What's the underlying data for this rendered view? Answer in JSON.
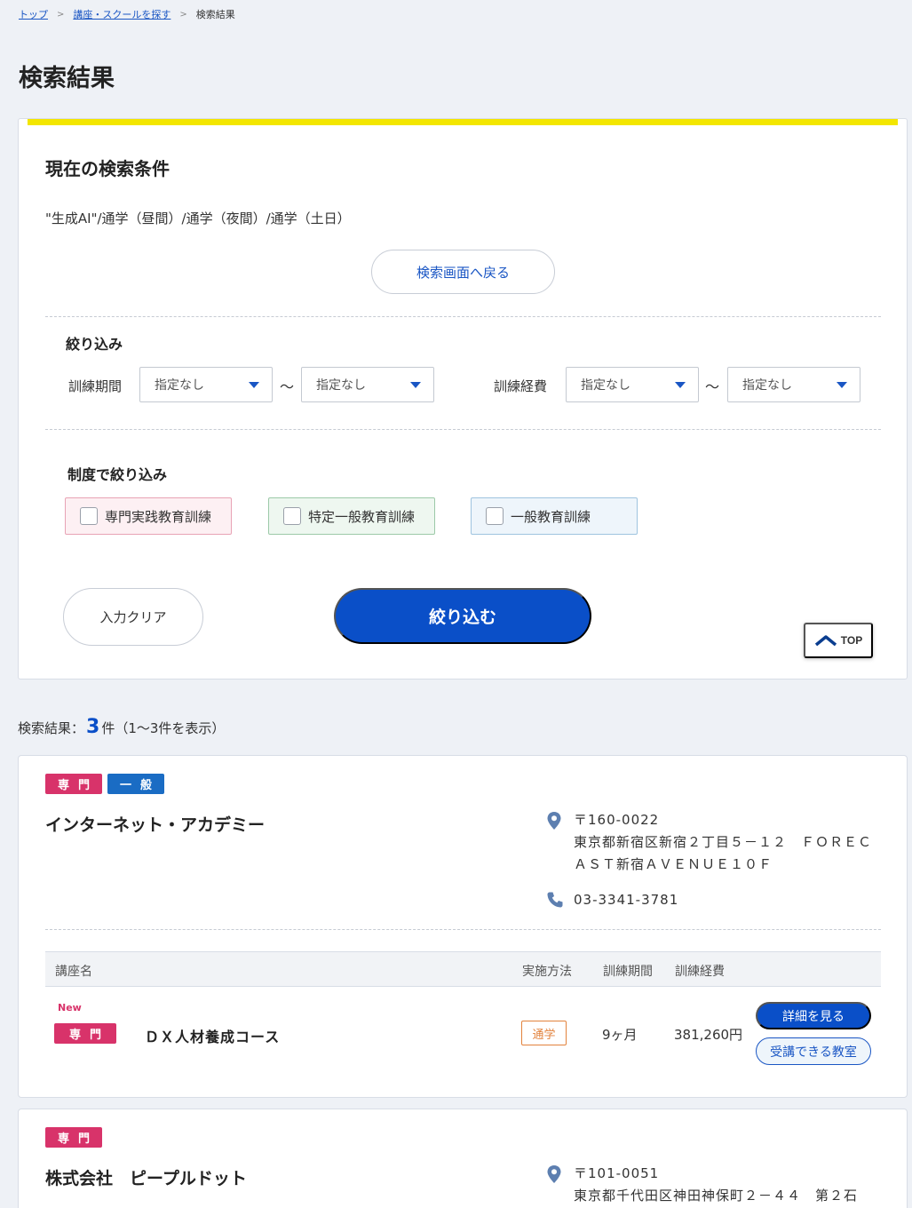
{
  "breadcrumb": {
    "top": "トップ",
    "search": "講座・スクールを探す",
    "current": "検索結果"
  },
  "page_title": "検索結果",
  "conditions": {
    "title": "現在の検索条件",
    "text": "\"生成AI\"/通学（昼間）/通学（夜間）/通学（土日）",
    "back_label": "検索画面へ戻る"
  },
  "filter": {
    "title": "絞り込み",
    "period_label": "訓練期間",
    "fee_label": "訓練経費",
    "select_default": "指定なし",
    "tilde": "～"
  },
  "system": {
    "title": "制度で絞り込み",
    "options": [
      "専門実践教育訓練",
      "特定一般教育訓練",
      "一般教育訓練"
    ]
  },
  "actions": {
    "clear_label": "入力クリア",
    "apply_label": "絞り込む",
    "top_label": "TOP"
  },
  "results": {
    "label": "検索結果：",
    "count": "3",
    "suffix": "件（1～3件を表示）"
  },
  "colors": {
    "brand": "#0a4fc8",
    "accent_yellow": "#f3e600",
    "tag_pink": "#d8336a",
    "tag_blue": "#1a6cc4",
    "method_orange": "#e2823c"
  },
  "schools": [
    {
      "tags": [
        "専門",
        "一般"
      ],
      "name": "インターネット・アカデミー",
      "postal": "〒160-0022",
      "address": "東京都新宿区新宿２丁目５－１２　ＦＯＲＥＣＡＳＴ新宿ＡＶＥＮＵＥ１０Ｆ",
      "tel": "03-3341-3781",
      "table_head": {
        "course": "講座名",
        "method": "実施方法",
        "period": "訓練期間",
        "fee": "訓練経費"
      },
      "course": {
        "new": "New",
        "tag": "専門",
        "name": "ＤＸ人材養成コース",
        "method": "通学",
        "period": "9ヶ月",
        "fee": "381,260円",
        "detail_label": "詳細を見る",
        "room_label": "受講できる教室"
      }
    },
    {
      "tags": [
        "専門"
      ],
      "name": "株式会社　ピープルドット",
      "postal": "〒101-0051",
      "address": "東京都千代田区神田神保町２－４４　第２石"
    }
  ]
}
